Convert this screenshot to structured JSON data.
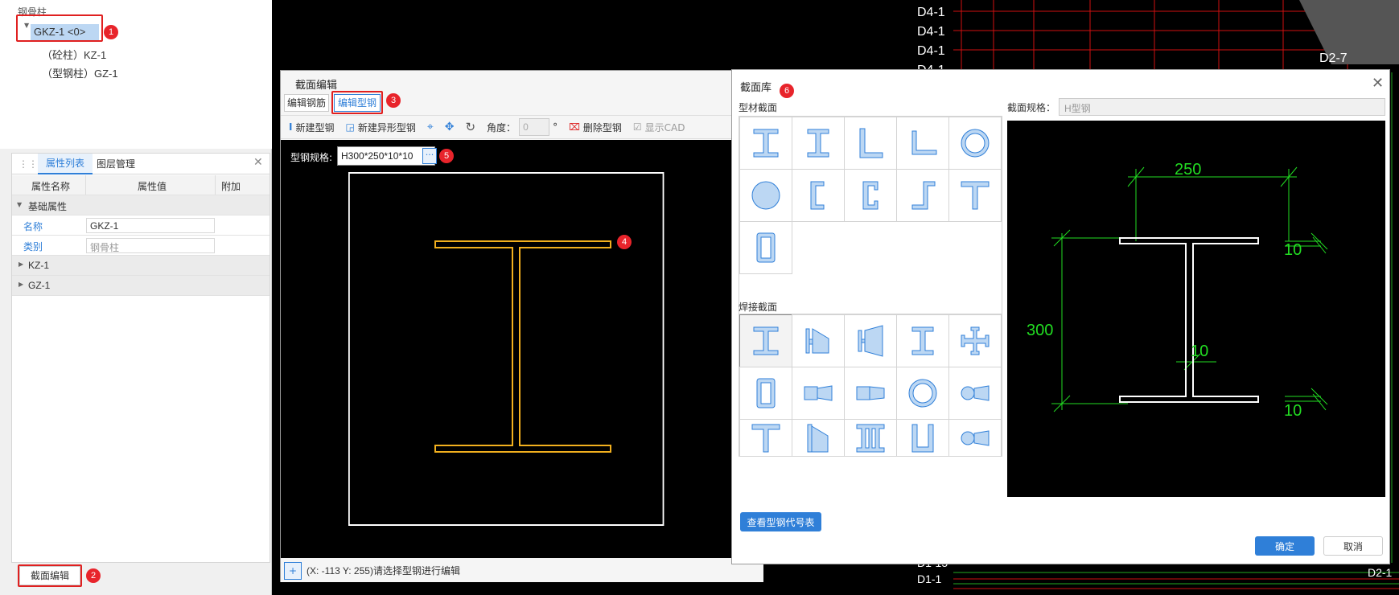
{
  "tree": {
    "group": "钢骨柱",
    "selected": "GKZ-1 <0>",
    "children": [
      "（砼柱）KZ-1",
      "（型钢柱）GZ-1"
    ]
  },
  "props": {
    "tabs": [
      "属性列表",
      "图层管理"
    ],
    "cols": [
      "属性名称",
      "属性值",
      "附加"
    ],
    "group": "基础属性",
    "rows": [
      {
        "name": "名称",
        "value": "GKZ-1"
      },
      {
        "name": "类别",
        "value": "钢骨柱"
      }
    ],
    "subgroups": [
      "KZ-1",
      "GZ-1"
    ]
  },
  "bottom_btn": "截面编辑",
  "badges": [
    "1",
    "2",
    "3",
    "4",
    "5",
    "6"
  ],
  "section_edit": {
    "title": "截面编辑",
    "tabs": [
      "编辑钢筋",
      "编辑型钢"
    ],
    "toolbar": {
      "new": "新建型钢",
      "new_irregular": "新建异形型钢",
      "angle_label": "角度：",
      "angle_value": "0",
      "degree": "°",
      "delete": "删除型钢",
      "show_cad": "显示CAD"
    },
    "spec_label": "型钢规格:",
    "spec_value": "H300*250*10*10",
    "more": "···",
    "status": "(X: -113 Y: 255)请选择型钢进行编辑"
  },
  "library": {
    "title": "截面库",
    "profiles_title": "型材截面",
    "welded_title": "焊接截面",
    "spec_label": "截面规格：",
    "spec_value": "H型钢",
    "code_btn": "查看型钢代号表",
    "ok": "确定",
    "cancel": "取消",
    "dims": {
      "width": "250",
      "height": "300",
      "flange_top": "10",
      "web": "10",
      "flange_bottom": "10"
    }
  },
  "cad_labels": [
    "D4-1",
    "D4-1",
    "D4-1",
    "D4-1",
    "D2-7",
    "D1-15",
    "D1-1",
    "D2-1"
  ],
  "colors": {
    "accent": "#2f7fd8",
    "badge": "#e8242b",
    "highlight": "#e02020",
    "steel": "#f2b01e",
    "dim": "#22dd22",
    "grid_red": "#d01010"
  }
}
